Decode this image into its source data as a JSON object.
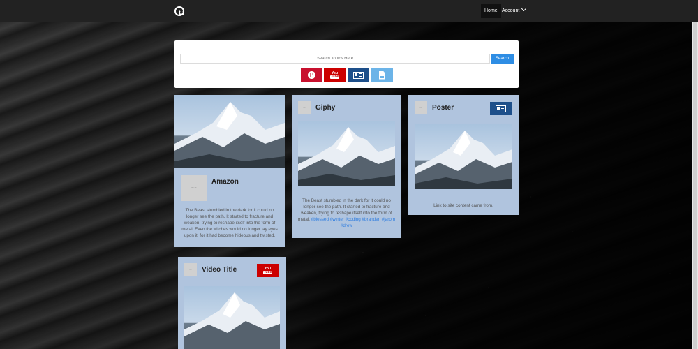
{
  "nav": {
    "home_label": "Home",
    "account_label": "Account"
  },
  "search": {
    "placeholder": "Search Topics Here",
    "button_label": "Search",
    "sources": [
      "pinterest",
      "youtube",
      "news",
      "document"
    ]
  },
  "cards": {
    "amazon": {
      "thumb_text": "75×75",
      "title": "Amazon",
      "text": "The Beast stumbled in the dark for it could no longer see the path. It started to fracture and weaken, trying to reshape itself into the form of metal. Even the witches would no longer lay eyes upon it, for it had become hideous and twisted."
    },
    "giphy": {
      "thumb_text": "•••",
      "title": "Giphy",
      "text": "The Beast stumbled in the dark for it could no longer see the path. It started to fracture and weaken, trying to reshape itself into the form of metal.",
      "tags": "#blessed #winter #coding #branden #jarom #drew"
    },
    "poster": {
      "thumb_text": "•••",
      "title": "Poster",
      "text": "Link to site content came from."
    },
    "video": {
      "thumb_text": "•••",
      "title": "Video Title"
    }
  },
  "colors": {
    "card_bg": "#b0c4de",
    "search_button": "#2e8de4",
    "pinterest": "#c8102e",
    "youtube": "#cc0000",
    "news": "#1d4f8a",
    "document": "#6cb4e8",
    "tag_link": "#2e7de0"
  }
}
